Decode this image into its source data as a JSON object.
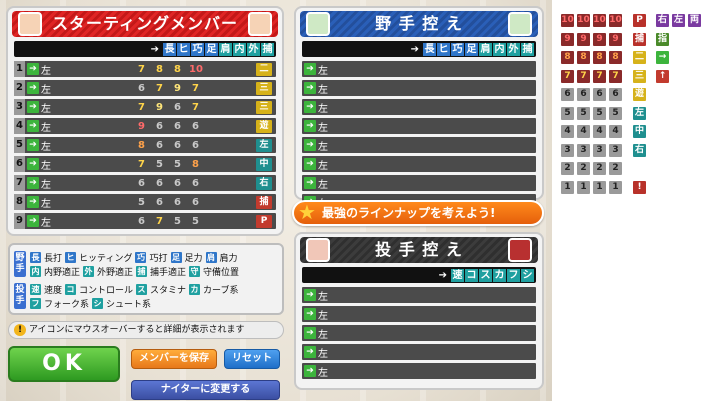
{
  "starting": {
    "title": "スターティングメンバー",
    "columns": [
      "長",
      "ヒ",
      "巧",
      "足",
      "肩",
      "内",
      "外",
      "捕"
    ],
    "players": [
      {
        "num": "1",
        "hand": "左",
        "stats": [
          "7",
          "8",
          "8",
          "10"
        ],
        "grades": [
          "c",
          "c",
          "c",
          "e"
        ],
        "pos": "二"
      },
      {
        "num": "2",
        "hand": "左",
        "stats": [
          "6",
          "7",
          "9",
          "7"
        ],
        "grades": [
          "lo",
          "c",
          "b",
          "c"
        ],
        "pos": "三"
      },
      {
        "num": "3",
        "hand": "左",
        "stats": [
          "7",
          "9",
          "6",
          "7"
        ],
        "grades": [
          "c",
          "b",
          "lo",
          "c"
        ],
        "pos": "三"
      },
      {
        "num": "4",
        "hand": "左",
        "stats": [
          "9",
          "6",
          "6",
          "6"
        ],
        "grades": [
          "e",
          "lo",
          "lo",
          "lo"
        ],
        "pos": "遊"
      },
      {
        "num": "5",
        "hand": "左",
        "stats": [
          "8",
          "6",
          "6",
          "6"
        ],
        "grades": [
          "d",
          "lo",
          "lo",
          "lo"
        ],
        "pos": "左"
      },
      {
        "num": "6",
        "hand": "左",
        "stats": [
          "7",
          "5",
          "5",
          "8"
        ],
        "grades": [
          "c",
          "lo",
          "lo",
          "d"
        ],
        "pos": "中"
      },
      {
        "num": "7",
        "hand": "左",
        "stats": [
          "6",
          "6",
          "6",
          "6"
        ],
        "grades": [
          "lo",
          "lo",
          "lo",
          "lo"
        ],
        "pos": "右"
      },
      {
        "num": "8",
        "hand": "左",
        "stats": [
          "5",
          "6",
          "6",
          "6"
        ],
        "grades": [
          "lo",
          "lo",
          "lo",
          "lo"
        ],
        "pos": "捕"
      },
      {
        "num": "9",
        "hand": "左",
        "stats": [
          "6",
          "7",
          "5",
          "5"
        ],
        "grades": [
          "lo",
          "c",
          "lo",
          "lo"
        ],
        "pos": "P"
      }
    ]
  },
  "bench": {
    "title": "野 手 控 え",
    "columns": [
      "長",
      "ヒ",
      "巧",
      "足",
      "肩",
      "内",
      "外",
      "捕"
    ],
    "rows": [
      "左",
      "左",
      "左",
      "左",
      "左",
      "左",
      "左",
      "左"
    ]
  },
  "banner": "最強のラインナップを考えよう!",
  "bullpen": {
    "title": "投 手 控 え",
    "columns": [
      "速",
      "コ",
      "ス",
      "カ",
      "フ",
      "シ"
    ],
    "rows": [
      "左",
      "左",
      "左",
      "左",
      "左"
    ]
  },
  "legend": {
    "fielder_tag": "野手",
    "pitcher_tag": "投手",
    "fielder_lines": [
      [
        [
          "長",
          "長打"
        ],
        [
          "ヒ",
          "ヒッティング"
        ],
        [
          "巧",
          "巧打"
        ],
        [
          "足",
          "足力"
        ],
        [
          "肩",
          "肩力"
        ]
      ],
      [
        [
          "内",
          "内野適正"
        ],
        [
          "外",
          "外野適正"
        ],
        [
          "捕",
          "捕手適正"
        ],
        [
          "守",
          "守備位置"
        ]
      ]
    ],
    "pitcher_lines": [
      [
        [
          "速",
          "速度"
        ],
        [
          "コ",
          "コントロール"
        ],
        [
          "ス",
          "スタミナ"
        ],
        [
          "カ",
          "カーブ系"
        ]
      ],
      [
        [
          "フ",
          "フォーク系"
        ],
        [
          "シ",
          "シュート系"
        ]
      ]
    ]
  },
  "note": "アイコンにマウスオーバーすると詳細が表示されます",
  "buttons": {
    "ok": "OK",
    "save": "メンバーを保存",
    "reset": "リセット",
    "night": "ナイターに変更する"
  },
  "palette": {
    "grades": [
      [
        "10",
        "10",
        "10",
        "10"
      ],
      [
        "9",
        "9",
        "9",
        "9"
      ],
      [
        "8",
        "8",
        "8",
        "8"
      ],
      [
        "7",
        "7",
        "7",
        "7"
      ],
      [
        "6",
        "6",
        "6",
        "6"
      ],
      [
        "5",
        "5",
        "5",
        "5"
      ],
      [
        "4",
        "4",
        "4",
        "4"
      ],
      [
        "3",
        "3",
        "3",
        "3"
      ],
      [
        "2",
        "2",
        "2",
        "2"
      ],
      [
        "1",
        "1",
        "1",
        "1"
      ]
    ],
    "positions": [
      "P",
      "捕",
      "二",
      "三",
      "遊",
      "左",
      "中",
      "右",
      "!"
    ],
    "hands": [
      "右",
      "左",
      "両"
    ],
    "extras": [
      "指",
      "→",
      "↑"
    ]
  }
}
